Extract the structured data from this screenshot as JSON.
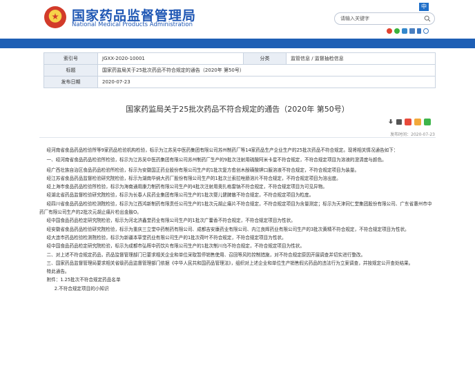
{
  "header": {
    "logo_cn": "国家药品监督管理局",
    "logo_en": "National Medical Products Administration",
    "lang_label": "中",
    "search_placeholder": "请输入关键字"
  },
  "info_table": {
    "rows": [
      [
        {
          "label": "索引号",
          "value": "JGXX-2020-10001"
        },
        {
          "label": "分类",
          "value": "监管信息 / 监督抽检信息"
        }
      ],
      [
        {
          "label": "标题",
          "value": "国家药监局关于25批次药品不符合规定的通告（2020年 第50号）"
        }
      ],
      [
        {
          "label": "发布日期",
          "value": "2020-07-23"
        }
      ]
    ]
  },
  "article": {
    "title": "国家药监局关于25批次药品不符合规定的通告（2020年 第50号）",
    "publish_time": "发布时间：2020-07-23",
    "paragraphs": [
      "经河南省食品药品检验所等9家药品检验机构检验，标示为江苏吴中医药集团有限公司苏州制药厂等14家药品生产企业生产的25批次药品不符合规定。现将相关情况通告如下：",
      "一、经河南省食品药品检验所检验，标示为江苏吴中医药集团有限公司苏州制药厂生产的9批次注射用硫酸阿米卡星不符合规定，不符合规定项目为溶液的澄清度与颜色。",
      "经广西壮族自治区食品药品检验所检验，标示为安徽国正药业股份有限公司生产的1批次复方愈创木酚磺酸钾口服溶液不符合规定，不符合规定项目为装量。",
      "经江苏省食品药品监督检验研究院检验，标示为湖南华纳大药厂股份有限公司生产的1批次兰索拉唑肠溶片不符合规定，不符合规定项目为溶出度。",
      "经上海市食品药品检验所检验，标示为海南通用康力制药有限公司生产的4批次注射用奥扎格雷钠不符合规定，不符合规定项目为可见异物。",
      "经湖北省药品监督检验研究院检验，标示为长春人民药业集团有限公司生产的1批次婴儿健脾散不符合规定，不符合规定项目为粒度。",
      "经四川省食品药品检验检测院检验，标示为江西鸿新制药有限责任公司生产的1批次元胡止痛片不符合规定，不符合规定项目为含量测定；标示为天津同仁堂集团股份有限公司、广东省惠州市中药厂有限公司生产的2批次元胡止痛片检出金胺O。",
      "经中国食品药品检定研究院检验，标示为河北济鑫堂药业有限公司生产的1批次广藿香不符合规定，不符合规定项目为性状。",
      "经安徽省食品药品检验研究院检验，标示为重庆三立堂中药制药有限公司、成都吉安康药业有限公司、内江良辉药业有限公司生产的3批次黄精不符合规定，不符合规定项目为性状。",
      "经大连市药品检验检测院检验，标示为新疆本草堂药业有限公司生产的1批次荷叶不符合规定，不符合规定项目为性状。",
      "经中国食品药品检定研究院检验，标示为成都市弘晖中药饮片有限公司生产的1批次制川乌不符合规定，不符合规定项目为性状。",
      "二、对上述不符合规定药品，药品监督管理部门已要求相关企业和单位采取暂停销售使用、召回等风险控制措施，对不符合规定原因开展调查并切实进行整改。",
      "三、国家药品监督管理局要求相关省级药品监督管理部门依据《中华人民共和国药品管理法》，组织对上述企业和单位生产销售假劣药品的违法行为立案调查，并按规定公开查处结果。",
      "特此通告。",
      "附件：1.25批次不符合规定药品名单"
    ],
    "attachment_2": "2.不符合规定项目的小知识"
  },
  "colors": {
    "brand_blue": "#1f57b4",
    "bar_blue": "#1e5fb5",
    "table_label_bg": "#e9eef5"
  }
}
